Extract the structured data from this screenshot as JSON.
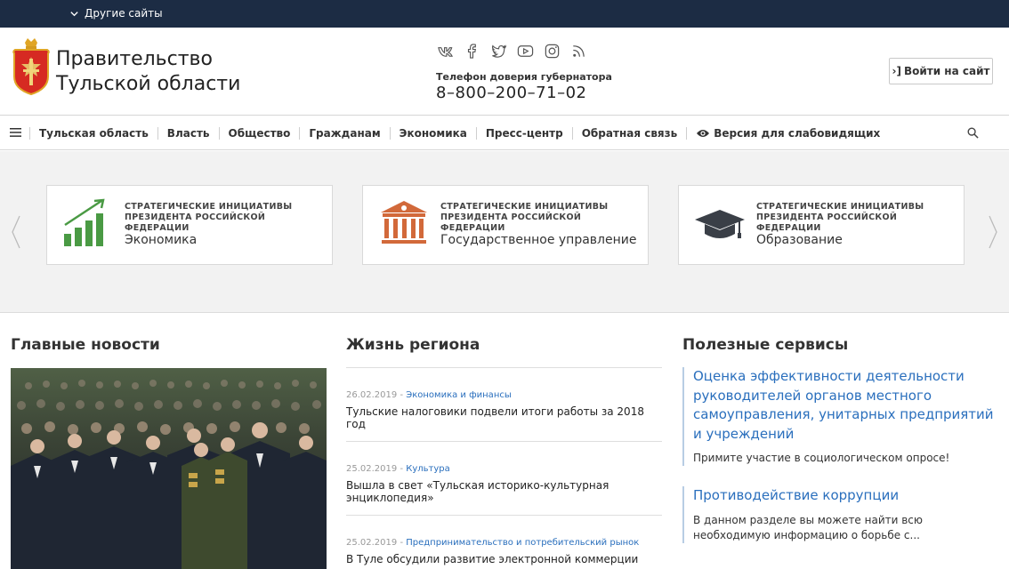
{
  "topbar": {
    "other_sites": "Другие сайты"
  },
  "header": {
    "title_line1": "Правительство",
    "title_line2": "Тульской области",
    "hotline_label": "Телефон доверия губернатора",
    "hotline_phone": "8–800–200–71–02",
    "login_label": "Войти на сайт",
    "socials": [
      "vk-icon",
      "facebook-icon",
      "twitter-icon",
      "youtube-icon",
      "instagram-icon",
      "rss-icon"
    ]
  },
  "nav": {
    "items": [
      "Тульская область",
      "Власть",
      "Общество",
      "Гражданам",
      "Экономика",
      "Пресс-центр",
      "Обратная связь"
    ],
    "accessibility": "Версия для слабовидящих"
  },
  "carousel": {
    "cards": [
      {
        "kicker": "Стратегические инициативы Президента Российской Федерации",
        "title": "Экономика",
        "icon": "growth-chart-icon",
        "color": "#4a9a44"
      },
      {
        "kicker": "Стратегические инициативы Президента Российской Федерации",
        "title": "Государственное управление",
        "icon": "government-building-icon",
        "color": "#d2693a"
      },
      {
        "kicker": "Стратегические инициативы Президента Российской Федерации",
        "title": "Образование",
        "icon": "graduation-cap-icon",
        "color": "#3a3f47"
      }
    ]
  },
  "sections": {
    "main_news": "Главные новости",
    "region_life": "Жизнь региона",
    "services": "Полезные сервисы"
  },
  "region_news": [
    {
      "date": "26.02.2019",
      "sep": " - ",
      "category": "Экономика и финансы",
      "title": "Тульские налоговики подвели итоги работы за 2018 год"
    },
    {
      "date": "25.02.2019",
      "sep": " - ",
      "category": "Культура",
      "title": "Вышла в свет «Тульская историко-культурная энциклопедия»"
    },
    {
      "date": "25.02.2019",
      "sep": " - ",
      "category": "Предпринимательство и потребительский рынок",
      "title": "В Туле обсудили развитие электронной коммерции"
    }
  ],
  "services": [
    {
      "title": "Оценка эффективности деятельности руководителей органов местного самоуправления, унитарных предприятий и учреждений",
      "desc": "Примите участие в социологическом опросе!"
    },
    {
      "title": "Противодействие коррупции",
      "desc": "В данном разделе вы можете найти всю необходимую информацию о борьбе с..."
    }
  ],
  "colors": {
    "topbar": "#1c2c44",
    "link": "#2a6fbd",
    "carousel_bg": "#f2f2f2"
  }
}
